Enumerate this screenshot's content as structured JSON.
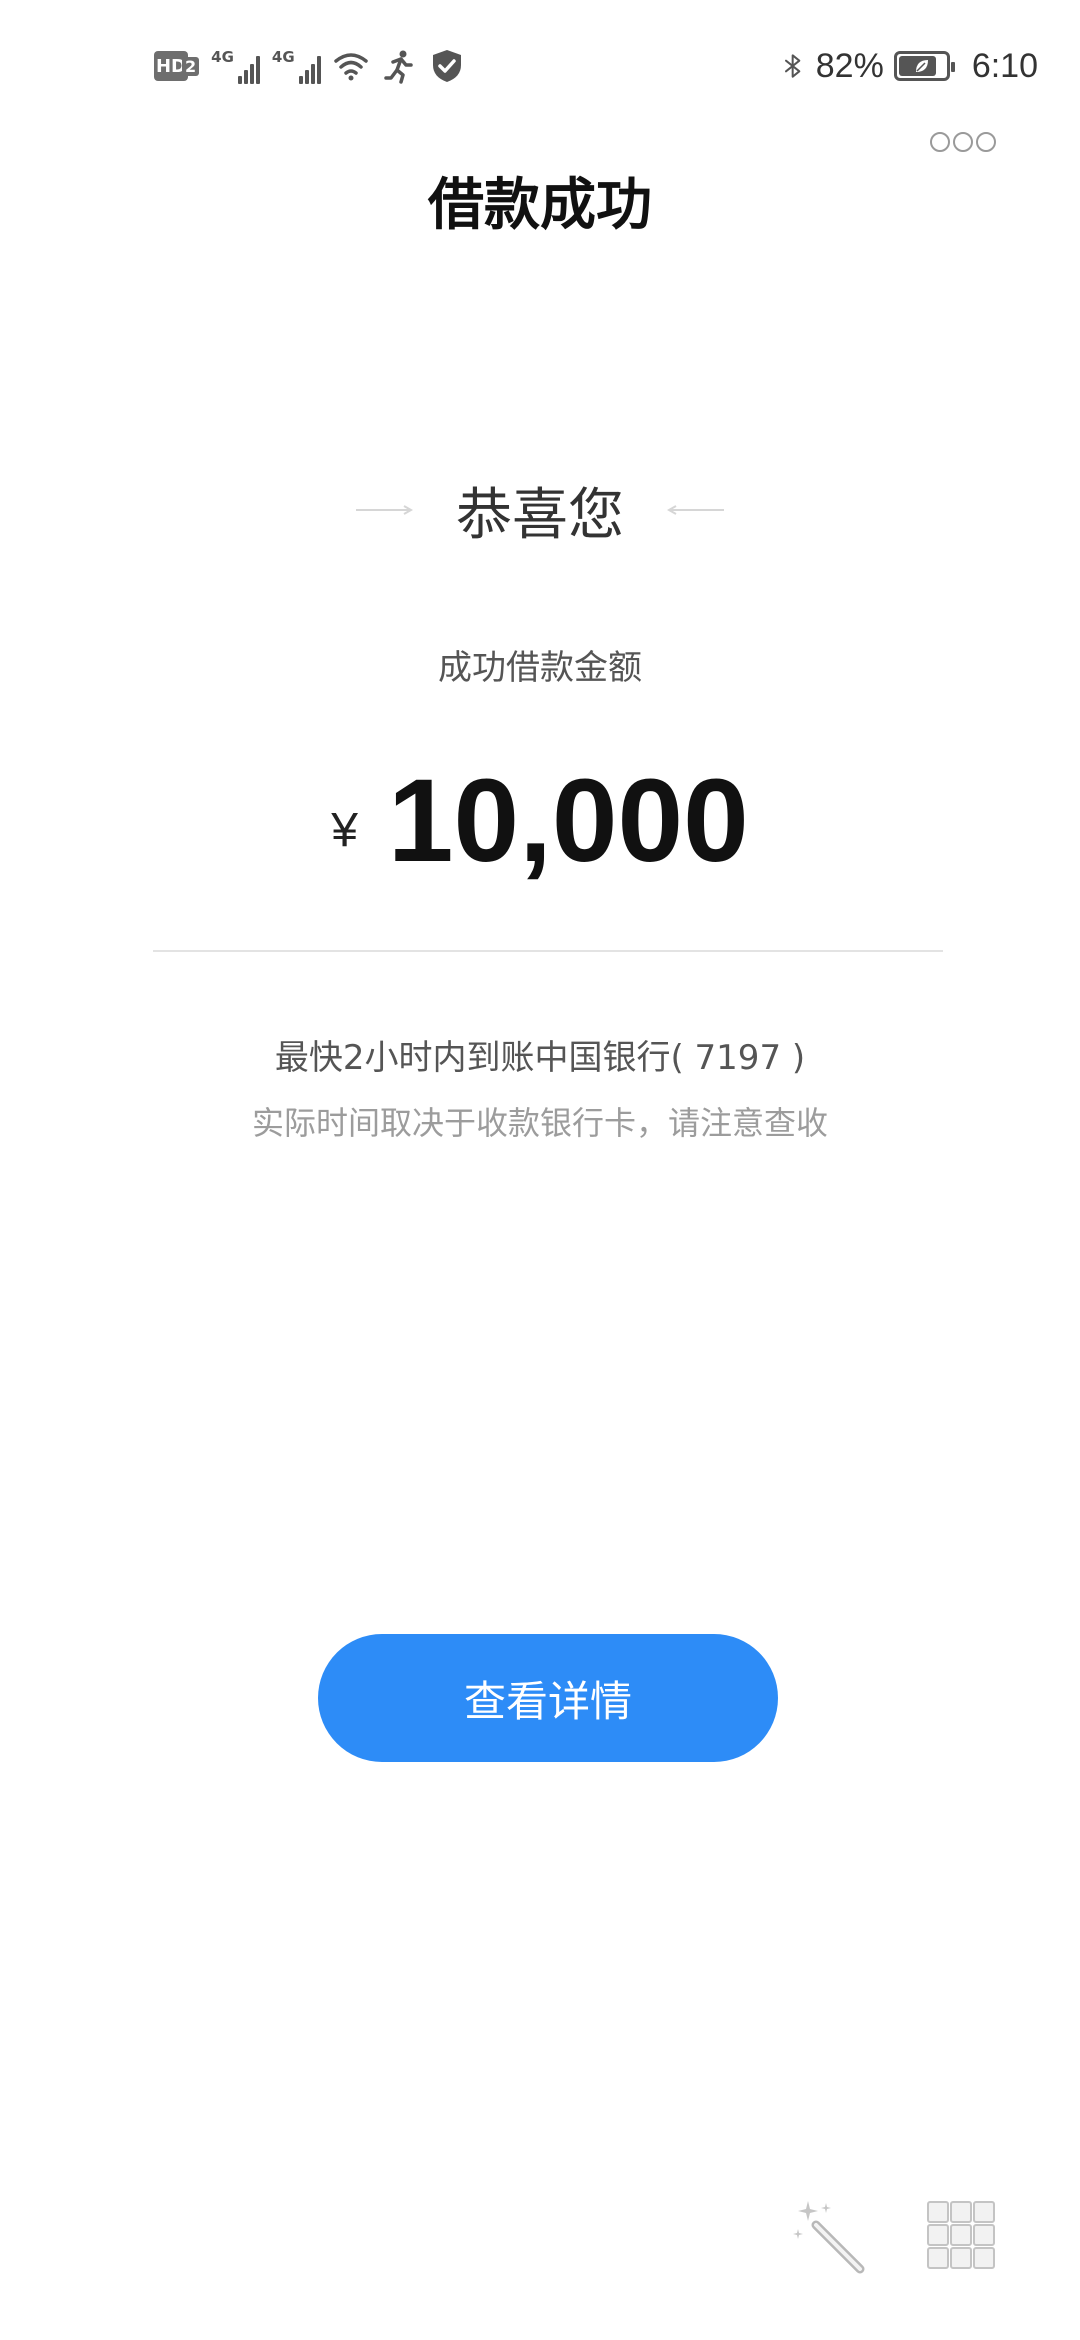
{
  "status_bar": {
    "hd_label": "HD",
    "hd_sub": "2",
    "net1_label": "4G",
    "net2_label": "4G",
    "battery_percent": "82%",
    "battery_level": 0.82,
    "time": "6:10",
    "icons": [
      "hd-icon",
      "signal-4g-icon",
      "signal-4g-icon",
      "wifi-icon",
      "running-icon",
      "shield-icon",
      "bluetooth-icon",
      "battery-icon"
    ]
  },
  "header": {
    "title": "借款成功",
    "more_icon": "more-dots-icon"
  },
  "result": {
    "congrats": "恭喜您",
    "amount_label": "成功借款金额",
    "currency": "¥",
    "amount": "10,000",
    "arrival_text": "最快2小时内到账中国银行( 7197 )",
    "arrival_note": "实际时间取决于收款银行卡，请注意查收"
  },
  "actions": {
    "details_button": "查看详情"
  },
  "floating_tools": {
    "wand_icon": "magic-wand-icon",
    "grid_icon": "grid-icon"
  },
  "colors": {
    "accent": "#2d8cf7",
    "text_primary": "#111111",
    "text_secondary": "#555555",
    "text_hint": "#9c9c9c",
    "divider": "#e3e3e3"
  }
}
